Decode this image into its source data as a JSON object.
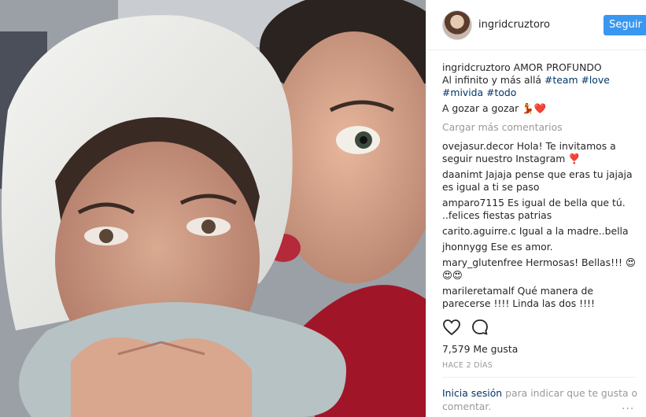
{
  "post": {
    "username": "ingridcruztoro",
    "follow_label": "Seguir"
  },
  "caption": {
    "username": "ingridcruztoro",
    "line1": "AMOR PROFUNDO",
    "line2_text": "Al infinito y más allá",
    "line2_tags": [
      "#team",
      "#love"
    ],
    "line3_tags": [
      "#mivida",
      "#todo"
    ],
    "line4": "A gozar a gozar 💃❤️"
  },
  "load_more_label": "Cargar más comentarios",
  "comments": [
    {
      "user": "ovejasur.decor",
      "text": "Hola! Te invitamos a seguir nuestro Instagram ❣️"
    },
    {
      "user": "daanimt",
      "text": "Jajaja pense que eras tu jajaja es igual a ti se paso"
    },
    {
      "user": "amparo7115",
      "text": "Es igual de bella que tú. ..felices fiestas patrias"
    },
    {
      "user": "carito.aguirre.c",
      "text": "Igual a la madre..bella"
    },
    {
      "user": "jhonnygg",
      "text": "Ese es amor."
    },
    {
      "user": "mary_glutenfree",
      "text": "Hermosas! Bellas!!! 😍😍😍"
    },
    {
      "user": "marileretamalf",
      "text": "Qué manera de parecerse !!!! Linda las dos !!!!"
    }
  ],
  "likes_text": "7,579 Me gusta",
  "timestamp_text": "HACE 2 DÍAS",
  "login": {
    "link_label": "Inicia sesión",
    "rest_text": "para indicar que te gusta o comentar."
  },
  "more_options_label": "...",
  "icons": {
    "like": "heart-outline-icon",
    "comment": "speech-bubble-icon"
  },
  "colors": {
    "follow_button": "#3897f0",
    "link": "#003569",
    "muted": "#999999"
  }
}
